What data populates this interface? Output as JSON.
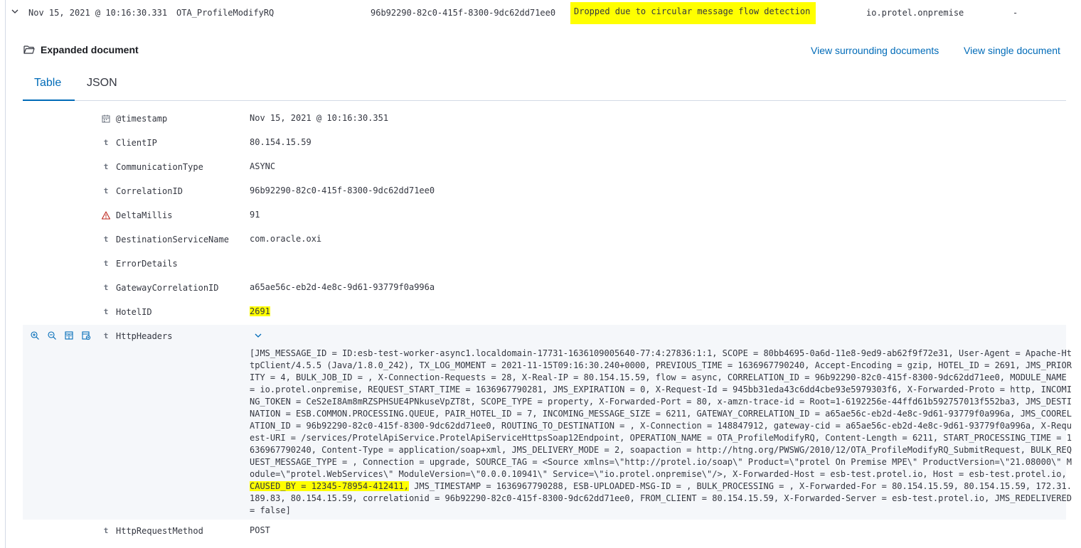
{
  "summary_row": {
    "timestamp": "Nov 15, 2021 @ 10:16:30.331",
    "operation": "OTA_ProfileModifyRQ",
    "correlation_id": "96b92290-82c0-415f-8300-9dc62dd71ee0",
    "message": "Dropped due to circular message flow detection",
    "module": "io.protel.onpremise",
    "dash": "-"
  },
  "expanded": {
    "title": "Expanded document",
    "link_surrounding": "View surrounding documents",
    "link_single": "View single document"
  },
  "tabs": [
    "Table",
    "JSON"
  ],
  "fields": [
    {
      "icon": "calendar-icon",
      "name": "@timestamp",
      "value": "Nov 15, 2021 @ 10:16:30.351"
    },
    {
      "icon": "t",
      "name": "ClientIP",
      "value": "80.154.15.59"
    },
    {
      "icon": "t",
      "name": "CommunicationType",
      "value": "ASYNC"
    },
    {
      "icon": "t",
      "name": "CorrelationID",
      "value": "96b92290-82c0-415f-8300-9dc62dd71ee0"
    },
    {
      "icon": "warning-icon",
      "name": "DeltaMillis",
      "value": "91"
    },
    {
      "icon": "t",
      "name": "DestinationServiceName",
      "value": "com.oracle.oxi"
    },
    {
      "icon": "t",
      "name": "ErrorDetails",
      "value": ""
    },
    {
      "icon": "t",
      "name": "GatewayCorrelationID",
      "value": "a65ae56c-eb2d-4e8c-9d61-93779f0a996a"
    },
    {
      "icon": "t",
      "name": "HotelID",
      "value": "2691"
    }
  ],
  "http_headers": {
    "name": "HttpHeaders",
    "lines": [
      "[JMS_MESSAGE_ID = ID:esb-test-worker-async1.localdomain-17731-1636109005640-77:4:27836:1:1, SCOPE = 80bb4695-0a6d-11e8-9ed9-ab62f9f72e31, User-Agent = Apache-Ht",
      "tpClient/4.5.5 (Java/1.8.0_242), TX_LOG_MOMENT = 2021-11-15T09:16:30.240+0000, PREVIOUS_TIME = 1636967790240, Accept-Encoding = gzip, HOTEL_ID = 2691, JMS_PRIOR",
      "ITY = 4, BULK_JOB_ID = , X-Connection-Requests = 28, X-Real-IP = 80.154.15.59, flow = async, CORRELATION_ID = 96b92290-82c0-415f-8300-9dc62dd71ee0, MODULE_NAME",
      "= io.protel.onpremise, REQUEST_START_TIME = 1636967790281, JMS_EXPIRATION = 0, X-Request-Id = 945bb31eda43c6dd4cbe93e5979303f6, X-Forwarded-Proto = http, INCOMI",
      "NG_TOKEN = CeS2eI8Am8mRZSPHSUE4PNkuseVpZT8t, SCOPE_TYPE = property, X-Forwarded-Port = 80, x-amzn-trace-id = Root=1-6192256e-44ffd61b592757013f552ba3, JMS_DESTI",
      "NATION = ESB.COMMON.PROCESSING.QUEUE, PAIR_HOTEL_ID = 7, INCOMING_MESSAGE_SIZE = 6211, GATEWAY_CORRELATION_ID = a65ae56c-eb2d-4e8c-9d61-93779f0a996a, JMS_COOREL",
      "ATION_ID = 96b92290-82c0-415f-8300-9dc62dd71ee0, ROUTING_TO_DESTINATION = , X-Connection = 148847912, gateway-cid = a65ae56c-eb2d-4e8c-9d61-93779f0a996a, X-Requ",
      "est-URI = /services/ProtelApiService.ProtelApiServiceHttpsSoap12Endpoint, OPERATION_NAME = OTA_ProfileModifyRQ, Content-Length = 6211, START_PROCESSING_TIME = 1",
      "636967790240, Content-Type = application/soap+xml, JMS_DELIVERY_MODE = 2, soapaction = http://htng.org/PWSWG/2010/12/OTA_ProfileModifyRQ_SubmitRequest, BULK_REQ",
      "UEST_MESSAGE_TYPE = , Connection = upgrade, SOURCE_TAG = <Source xmlns=\\\"http://protel.io/soap\\\" Product=\\\"protel On Premise MPE\\\" ProductVersion=\\\"21.08000\\\" M",
      "odule=\\\"protel.WebServices\\\" ModuleVersion=\\\"0.0.0.10941\\\" Service=\\\"io.protel.onpremise\\\"/>, X-Forwarded-Host = esb-test.protel.io, Host = esb-test.protel.io,",
      "CAUSED_BY = 12345-78954-412411,",
      " JMS_TIMESTAMP = 1636967790288, ESB-UPLOADED-MSG-ID = , BULK_PROCESSING = , X-Forwarded-For = 80.154.15.59, 80.154.15.59, 172.31.",
      "189.83, 80.154.15.59, correlationid = 96b92290-82c0-415f-8300-9dc62dd71ee0, FROM_CLIENT = 80.154.15.59, X-Forwarded-Server = esb-test.protel.io, JMS_REDELIVERED",
      "= false]"
    ]
  },
  "http_request_method": {
    "name": "HttpRequestMethod",
    "value": "POST"
  }
}
